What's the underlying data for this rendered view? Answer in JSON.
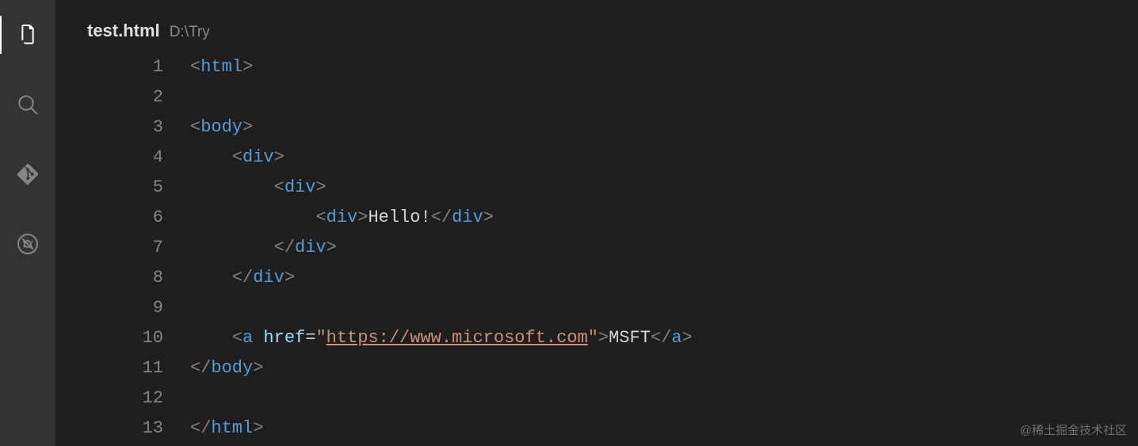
{
  "activity": {
    "items": [
      {
        "name": "explorer-icon",
        "active": true
      },
      {
        "name": "search-icon",
        "active": false
      },
      {
        "name": "git-icon",
        "active": false
      },
      {
        "name": "debug-icon",
        "active": false
      }
    ]
  },
  "header": {
    "filename": "test.html",
    "filepath": "D:\\Try"
  },
  "editor": {
    "line_numbers": [
      "1",
      "2",
      "3",
      "4",
      "5",
      "6",
      "7",
      "8",
      "9",
      "10",
      "11",
      "12",
      "13"
    ],
    "lines": [
      [
        {
          "t": "pun",
          "v": "<"
        },
        {
          "t": "tag",
          "v": "html"
        },
        {
          "t": "pun",
          "v": ">"
        }
      ],
      [],
      [
        {
          "t": "pun",
          "v": "<"
        },
        {
          "t": "tag",
          "v": "body"
        },
        {
          "t": "pun",
          "v": ">"
        }
      ],
      [
        {
          "t": "txt",
          "v": "    "
        },
        {
          "t": "pun",
          "v": "<"
        },
        {
          "t": "tag",
          "v": "div"
        },
        {
          "t": "pun",
          "v": ">"
        }
      ],
      [
        {
          "t": "txt",
          "v": "        "
        },
        {
          "t": "pun",
          "v": "<"
        },
        {
          "t": "tag",
          "v": "div"
        },
        {
          "t": "pun",
          "v": ">"
        }
      ],
      [
        {
          "t": "txt",
          "v": "            "
        },
        {
          "t": "pun",
          "v": "<"
        },
        {
          "t": "tag",
          "v": "div"
        },
        {
          "t": "pun",
          "v": ">"
        },
        {
          "t": "txt",
          "v": "Hello!"
        },
        {
          "t": "pun",
          "v": "</"
        },
        {
          "t": "tag",
          "v": "div"
        },
        {
          "t": "pun",
          "v": ">"
        }
      ],
      [
        {
          "t": "txt",
          "v": "        "
        },
        {
          "t": "pun",
          "v": "</"
        },
        {
          "t": "tag",
          "v": "div"
        },
        {
          "t": "pun",
          "v": ">"
        }
      ],
      [
        {
          "t": "txt",
          "v": "    "
        },
        {
          "t": "pun",
          "v": "</"
        },
        {
          "t": "tag",
          "v": "div"
        },
        {
          "t": "pun",
          "v": ">"
        }
      ],
      [],
      [
        {
          "t": "txt",
          "v": "    "
        },
        {
          "t": "pun",
          "v": "<"
        },
        {
          "t": "tag",
          "v": "a"
        },
        {
          "t": "txt",
          "v": " "
        },
        {
          "t": "attr",
          "v": "href"
        },
        {
          "t": "op",
          "v": "="
        },
        {
          "t": "str",
          "v": "\""
        },
        {
          "t": "str u",
          "v": "https://www.microsoft.com"
        },
        {
          "t": "str",
          "v": "\""
        },
        {
          "t": "pun",
          "v": ">"
        },
        {
          "t": "txt",
          "v": "MSFT"
        },
        {
          "t": "pun",
          "v": "</"
        },
        {
          "t": "tag",
          "v": "a"
        },
        {
          "t": "pun",
          "v": ">"
        }
      ],
      [
        {
          "t": "pun",
          "v": "</"
        },
        {
          "t": "tag",
          "v": "body"
        },
        {
          "t": "pun",
          "v": ">"
        }
      ],
      [],
      [
        {
          "t": "pun",
          "v": "</"
        },
        {
          "t": "tag",
          "v": "html"
        },
        {
          "t": "pun",
          "v": ">"
        }
      ]
    ]
  },
  "watermark": "@稀土掘金技术社区"
}
